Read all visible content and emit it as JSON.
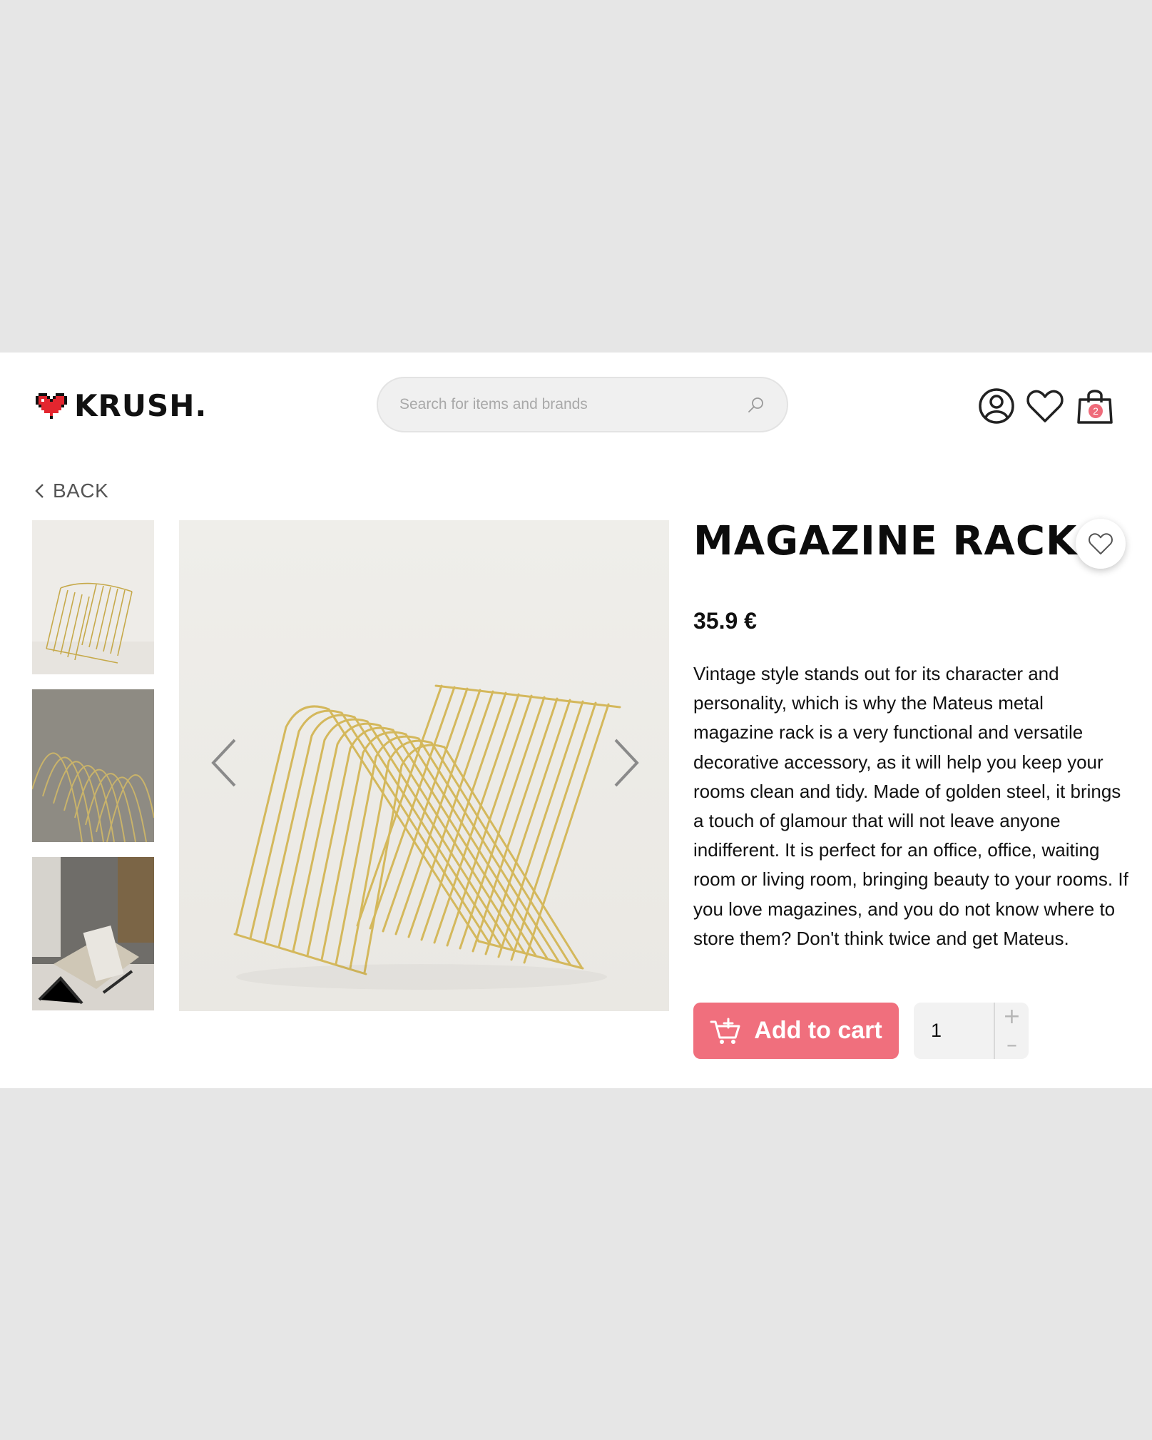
{
  "header": {
    "logo_text": "KRUSH.",
    "search_placeholder": "Search for items and brands",
    "cart_count": "2"
  },
  "nav": {
    "back_label": "BACK"
  },
  "product": {
    "title": "MAGAZINE RACK",
    "price": "35.9 €",
    "description": "Vintage style stands out for its character and personality, which is why the Mateus metal magazine rack is a very functional and versatile decorative accessory, as it will help you keep your rooms clean and tidy. Made of golden steel, it brings a touch of glamour that will not leave anyone indifferent. It is perfect for an office, office, waiting room or living room, bringing beauty to your rooms. If you love magazines, and you do not know where to store them? Don't think twice and get Mateus.",
    "add_to_cart_label": "Add to cart",
    "quantity": "1",
    "increment_label": "+",
    "decrement_label": "–"
  },
  "colors": {
    "accent": "#f06f7d",
    "badge": "#ef6b7a",
    "page_background": "#e6e6e6"
  },
  "icons": [
    "heart-logo-icon",
    "search-icon",
    "user-icon",
    "heart-icon",
    "shopping-bag-icon",
    "chevron-left-icon",
    "chevron-right-icon",
    "cart-plus-icon"
  ]
}
